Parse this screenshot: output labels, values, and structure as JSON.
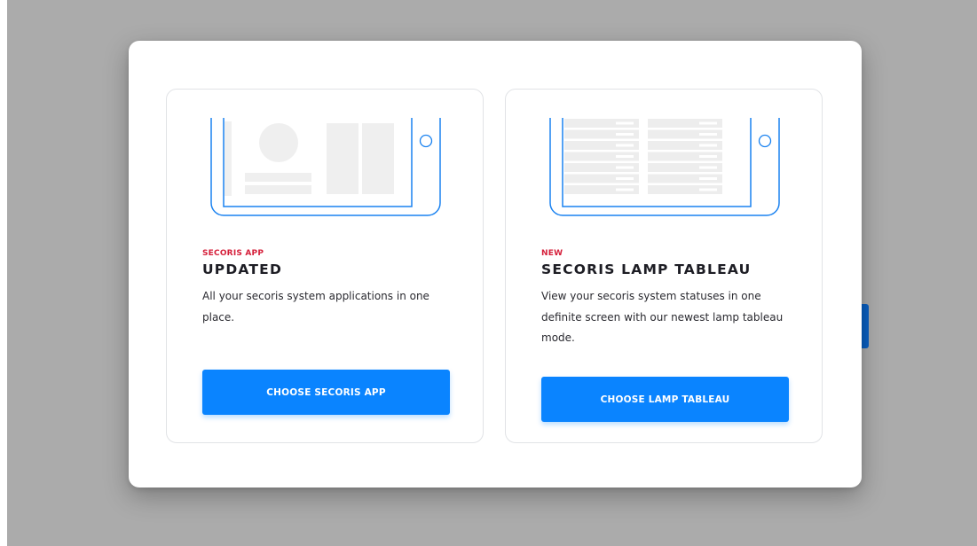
{
  "colors": {
    "accent": "#0a84ff",
    "eyebrow": "#d51f3a",
    "illustration_line": "#1a82f0",
    "backdrop": "#ababab"
  },
  "cards": [
    {
      "eyebrow": "SECORIS APP",
      "title": "UPDATED",
      "description": "All your secoris system applications in one place.",
      "button_label": "CHOOSE SECORIS APP",
      "illustration_icon": "phone-app-layout-illustration"
    },
    {
      "eyebrow": "NEW",
      "title": "SECORIS LAMP TABLEAU",
      "description": "View your secoris system statuses in one definite screen with our newest lamp tableau mode.",
      "button_label": "CHOOSE LAMP TABLEAU",
      "illustration_icon": "phone-lamp-tableau-illustration"
    }
  ]
}
